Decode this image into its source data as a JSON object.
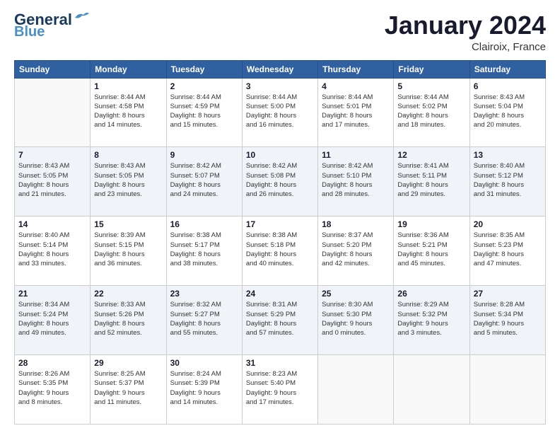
{
  "header": {
    "logo_line1": "General",
    "logo_line2": "Blue",
    "month": "January 2024",
    "location": "Clairoix, France"
  },
  "weekdays": [
    "Sunday",
    "Monday",
    "Tuesday",
    "Wednesday",
    "Thursday",
    "Friday",
    "Saturday"
  ],
  "weeks": [
    [
      {
        "day": "",
        "info": ""
      },
      {
        "day": "1",
        "info": "Sunrise: 8:44 AM\nSunset: 4:58 PM\nDaylight: 8 hours\nand 14 minutes."
      },
      {
        "day": "2",
        "info": "Sunrise: 8:44 AM\nSunset: 4:59 PM\nDaylight: 8 hours\nand 15 minutes."
      },
      {
        "day": "3",
        "info": "Sunrise: 8:44 AM\nSunset: 5:00 PM\nDaylight: 8 hours\nand 16 minutes."
      },
      {
        "day": "4",
        "info": "Sunrise: 8:44 AM\nSunset: 5:01 PM\nDaylight: 8 hours\nand 17 minutes."
      },
      {
        "day": "5",
        "info": "Sunrise: 8:44 AM\nSunset: 5:02 PM\nDaylight: 8 hours\nand 18 minutes."
      },
      {
        "day": "6",
        "info": "Sunrise: 8:43 AM\nSunset: 5:04 PM\nDaylight: 8 hours\nand 20 minutes."
      }
    ],
    [
      {
        "day": "7",
        "info": ""
      },
      {
        "day": "8",
        "info": "Sunrise: 8:43 AM\nSunset: 5:05 PM\nDaylight: 8 hours\nand 23 minutes."
      },
      {
        "day": "9",
        "info": "Sunrise: 8:42 AM\nSunset: 5:07 PM\nDaylight: 8 hours\nand 24 minutes."
      },
      {
        "day": "10",
        "info": "Sunrise: 8:42 AM\nSunset: 5:08 PM\nDaylight: 8 hours\nand 26 minutes."
      },
      {
        "day": "11",
        "info": "Sunrise: 8:42 AM\nSunset: 5:10 PM\nDaylight: 8 hours\nand 28 minutes."
      },
      {
        "day": "12",
        "info": "Sunrise: 8:41 AM\nSunset: 5:11 PM\nDaylight: 8 hours\nand 29 minutes."
      },
      {
        "day": "13",
        "info": "Sunrise: 8:40 AM\nSunset: 5:12 PM\nDaylight: 8 hours\nand 31 minutes."
      }
    ],
    [
      {
        "day": "14",
        "info": ""
      },
      {
        "day": "15",
        "info": "Sunrise: 8:39 AM\nSunset: 5:15 PM\nDaylight: 8 hours\nand 36 minutes."
      },
      {
        "day": "16",
        "info": "Sunrise: 8:38 AM\nSunset: 5:17 PM\nDaylight: 8 hours\nand 38 minutes."
      },
      {
        "day": "17",
        "info": "Sunrise: 8:38 AM\nSunset: 5:18 PM\nDaylight: 8 hours\nand 40 minutes."
      },
      {
        "day": "18",
        "info": "Sunrise: 8:37 AM\nSunset: 5:20 PM\nDaylight: 8 hours\nand 42 minutes."
      },
      {
        "day": "19",
        "info": "Sunrise: 8:36 AM\nSunset: 5:21 PM\nDaylight: 8 hours\nand 45 minutes."
      },
      {
        "day": "20",
        "info": "Sunrise: 8:35 AM\nSunset: 5:23 PM\nDaylight: 8 hours\nand 47 minutes."
      }
    ],
    [
      {
        "day": "21",
        "info": ""
      },
      {
        "day": "22",
        "info": "Sunrise: 8:33 AM\nSunset: 5:26 PM\nDaylight: 8 hours\nand 52 minutes."
      },
      {
        "day": "23",
        "info": "Sunrise: 8:32 AM\nSunset: 5:27 PM\nDaylight: 8 hours\nand 55 minutes."
      },
      {
        "day": "24",
        "info": "Sunrise: 8:31 AM\nSunset: 5:29 PM\nDaylight: 8 hours\nand 57 minutes."
      },
      {
        "day": "25",
        "info": "Sunrise: 8:30 AM\nSunset: 5:30 PM\nDaylight: 9 hours\nand 0 minutes."
      },
      {
        "day": "26",
        "info": "Sunrise: 8:29 AM\nSunset: 5:32 PM\nDaylight: 9 hours\nand 3 minutes."
      },
      {
        "day": "27",
        "info": "Sunrise: 8:28 AM\nSunset: 5:34 PM\nDaylight: 9 hours\nand 5 minutes."
      }
    ],
    [
      {
        "day": "28",
        "info": ""
      },
      {
        "day": "29",
        "info": "Sunrise: 8:25 AM\nSunset: 5:37 PM\nDaylight: 9 hours\nand 11 minutes."
      },
      {
        "day": "30",
        "info": "Sunrise: 8:24 AM\nSunset: 5:39 PM\nDaylight: 9 hours\nand 14 minutes."
      },
      {
        "day": "31",
        "info": "Sunrise: 8:23 AM\nSunset: 5:40 PM\nDaylight: 9 hours\nand 17 minutes."
      },
      {
        "day": "",
        "info": ""
      },
      {
        "day": "",
        "info": ""
      },
      {
        "day": "",
        "info": ""
      }
    ]
  ],
  "week1_sun_info": "Sunrise: 8:43 AM\nSunset: 5:05 PM\nDaylight: 8 hours\nand 21 minutes.",
  "week3_sun_info": "Sunrise: 8:40 AM\nSunset: 5:14 PM\nDaylight: 8 hours\nand 33 minutes.",
  "week4_sun_info": "Sunrise: 8:34 AM\nSunset: 5:24 PM\nDaylight: 8 hours\nand 49 minutes.",
  "week5_sun_info": "Sunrise: 8:26 AM\nSunset: 5:35 PM\nDaylight: 9 hours\nand 8 minutes."
}
